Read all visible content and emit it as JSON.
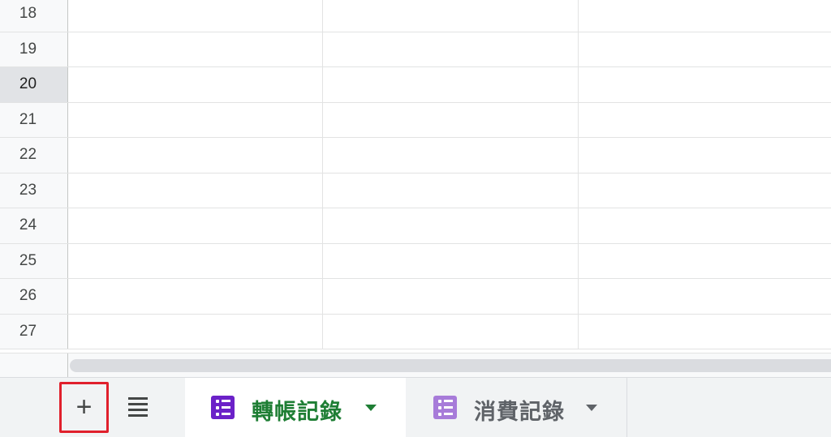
{
  "grid": {
    "rows": [
      {
        "number": "18",
        "selected": false
      },
      {
        "number": "19",
        "selected": false
      },
      {
        "number": "20",
        "selected": true
      },
      {
        "number": "21",
        "selected": false
      },
      {
        "number": "22",
        "selected": false
      },
      {
        "number": "23",
        "selected": false
      },
      {
        "number": "24",
        "selected": false
      },
      {
        "number": "25",
        "selected": false
      },
      {
        "number": "26",
        "selected": false
      },
      {
        "number": "27",
        "selected": false
      }
    ]
  },
  "tabbar": {
    "add_sheet_icon": "plus-icon",
    "add_sheet_label": "+",
    "all_sheets_icon": "list-icon",
    "tabs": [
      {
        "label": "轉帳記錄",
        "icon": "form-icon",
        "icon_color": "#6b21c8",
        "active": true,
        "text_color": "#1e7e34"
      },
      {
        "label": "消費記錄",
        "icon": "form-icon",
        "icon_color": "#a77bd9",
        "active": false,
        "text_color": "#5f6368"
      }
    ],
    "highlight_color": "#e0202c"
  }
}
